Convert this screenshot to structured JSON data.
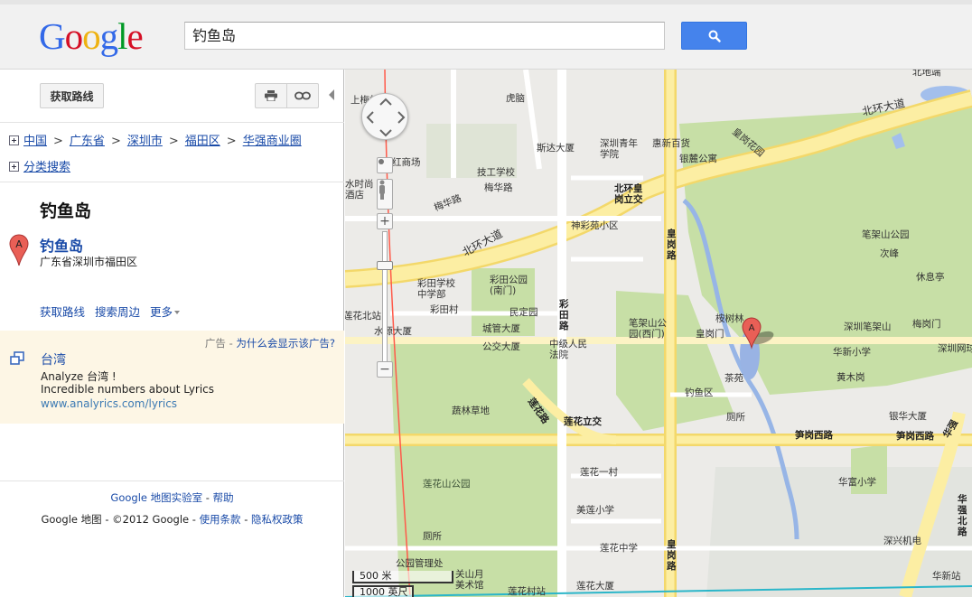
{
  "header": {
    "logo": "Google",
    "search_value": "钓鱼岛",
    "search_button": "search-icon"
  },
  "sidebar": {
    "route_button": "获取路线",
    "print_icon": "print-icon",
    "link_icon": "link-icon",
    "breadcrumb": [
      "中国",
      "广东省",
      "深圳市",
      "福田区",
      "华强商业圈"
    ],
    "breadcrumb_sep": ">",
    "category_search": "分类搜索",
    "heading": "钓鱼岛",
    "result": {
      "marker": "A",
      "name": "钓鱼岛",
      "address": "广东省深圳市福田区",
      "links": [
        "获取路线",
        "搜索周边",
        "更多"
      ]
    },
    "ad": {
      "label": "广告",
      "label_sep": " - ",
      "why_link": "为什么会显示该广告?",
      "title": "台湾",
      "line1": "Analyze 台湾 !",
      "line2": "Incredible numbers about Lyrics",
      "url": "www.analyrics.com/lyrics"
    },
    "footer": {
      "lab": "Google 地图实验室",
      "help": "帮助",
      "copyright": "Google 地图 - ©2012 Google - ",
      "terms": "使用条款",
      "privacy": "隐私权政策",
      "dash": " - "
    }
  },
  "map": {
    "marker": "A",
    "scale": [
      "500 米",
      "1000 英尺"
    ],
    "labels": {
      "l_meilin": "上梅林",
      "l_humeng": "虎脑",
      "l_bihu": "彩田",
      "l_beihuan1": "北环大道",
      "l_beihuan2": "北环大道",
      "l_sida": "斯达大厦",
      "l_shenzhen_qn": "深圳青年学院",
      "l_huiqian": "惠新百货",
      "l_yinli": "银麓公寓",
      "l_huanggang_ld": "皇岗花园",
      "l_hong": "红商场",
      "l_jigong": "技工学校",
      "l_meihua": "梅华路",
      "l_meihua2": "梅华路",
      "l_beihuan_lj": "北环皇岗立交",
      "l_water": "水时尚酒店",
      "l_shencai": "神彩苑小区",
      "l_bijia": "笔架山公园",
      "l_ciling": "次峰",
      "l_xiuxi": "休息亭",
      "l_caitian_school": "彩田学校中学部",
      "l_caitian_park": "彩田公园(南门)",
      "l_caitian_road": "彩田路",
      "l_caitiancun": "彩田村",
      "l_minding": "民定园",
      "l_chengguan": "城管大厦",
      "l_gongjiao": "公交大厦",
      "l_zhongji": "中级人民法院",
      "l_bijia_west": "笔架山公园(西门)",
      "l_huanggangmen": "皇岗门",
      "l_lianhua_bei": "莲花北站",
      "l_shuiyuan": "水源大厦",
      "l_anshulin": "桉树林",
      "l_sz_bijia": "深圳笔架山",
      "l_meigang": "梅岗门",
      "l_huaxin": "华新小学",
      "l_sz_wangqiu": "深圳网球",
      "l_huangmu": "黄木岗",
      "l_chayuan": "茶苑",
      "l_diaoyu": "钓鱼区",
      "l_cesuo": "厕所",
      "l_yinhua": "银华大厦",
      "l_shucai": "蔬林草地",
      "l_lianhua_lj": "莲花立交",
      "l_lianhua_road": "莲花路",
      "l_sungang1": "笋岗西路",
      "l_sungang2": "笋岗西路",
      "l_lianhua1": "莲花一村",
      "l_huafu": "华富小学",
      "l_lianhua_park": "莲花山公园",
      "l_meijing": "美莲小学",
      "l_cesuo2": "厕所",
      "l_lianhua_zhong": "莲花中学",
      "l_shenxing": "深兴机电",
      "l_gongyuan_guanli": "公园管理处",
      "l_guanshan": "关山月美术馆",
      "l_lianhua_dasha": "莲花大厦",
      "l_lianhuacun": "莲花村站",
      "l_huanggang_road": "皇岗路",
      "l_huanggang_road2": "皇岗路",
      "l_huaqiang_bei": "华强北路",
      "l_huaxin2": "华新站",
      "l_beihua": "北地端",
      "l_huanggang_right": "华强"
    }
  }
}
